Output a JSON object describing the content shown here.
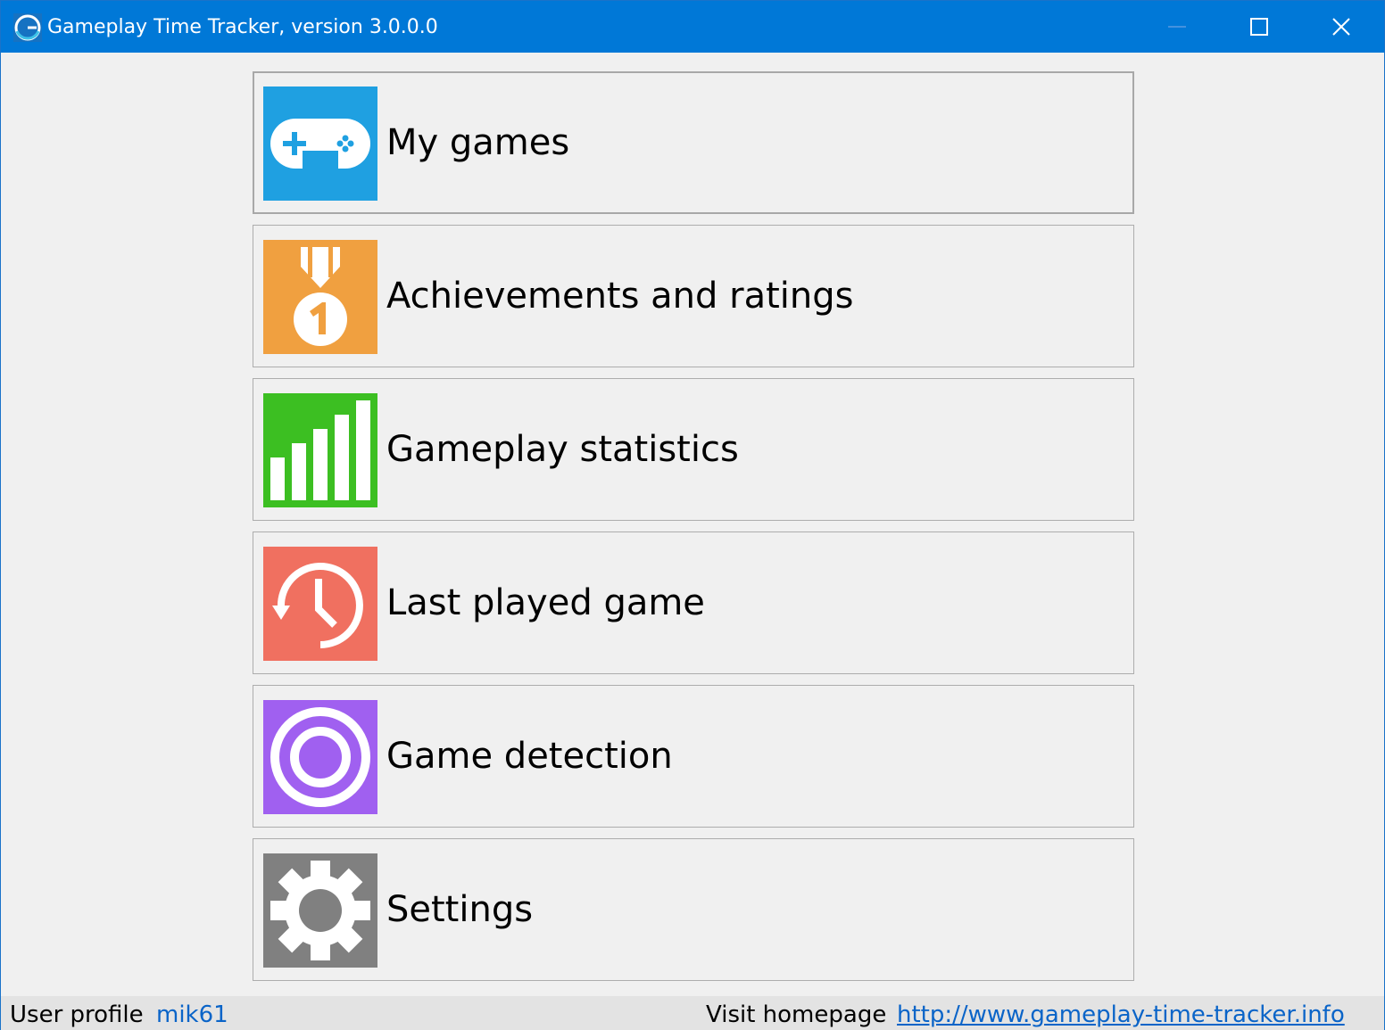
{
  "window": {
    "title": "Gameplay Time Tracker, version 3.0.0.0"
  },
  "menu": [
    {
      "label": "My games",
      "icon": "gamepad-icon",
      "color": "#1fa0e1"
    },
    {
      "label": "Achievements and ratings",
      "icon": "medal-icon",
      "color": "#f0a040"
    },
    {
      "label": "Gameplay statistics",
      "icon": "bar-chart-icon",
      "color": "#3cbf22"
    },
    {
      "label": "Last played game",
      "icon": "history-clock-icon",
      "color": "#f07060"
    },
    {
      "label": "Game detection",
      "icon": "target-icon",
      "color": "#a060f0"
    },
    {
      "label": "Settings",
      "icon": "gear-icon",
      "color": "#808080"
    }
  ],
  "status": {
    "profile_label": "User profile",
    "profile_name": "mik61",
    "homepage_label": "Visit homepage",
    "homepage_url": "http://www.gameplay-time-tracker.info"
  },
  "colors": {
    "titlebar": "#0078d7",
    "link": "#0a64c8"
  }
}
